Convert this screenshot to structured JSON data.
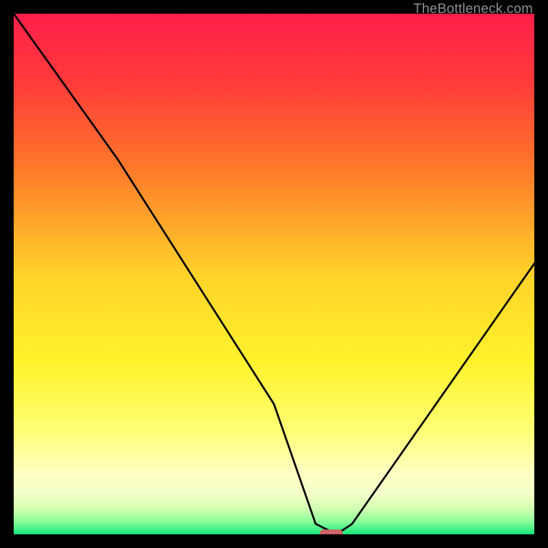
{
  "watermark": "TheBottleneck.com",
  "chart_data": {
    "type": "line",
    "title": "",
    "xlabel": "",
    "ylabel": "",
    "xlim": [
      0,
      100
    ],
    "ylim": [
      0,
      100
    ],
    "x": [
      0,
      20,
      50,
      58,
      62,
      65,
      100
    ],
    "values": [
      100,
      72,
      25,
      2,
      0,
      2,
      52
    ],
    "optimum_marker": {
      "x": 61,
      "y": 0
    },
    "background_gradient": {
      "stops": [
        {
          "pos": 0.0,
          "color": "#ff1f4b"
        },
        {
          "pos": 0.13,
          "color": "#ff3a3a"
        },
        {
          "pos": 0.3,
          "color": "#ff7a2a"
        },
        {
          "pos": 0.5,
          "color": "#ffd22a"
        },
        {
          "pos": 0.67,
          "color": "#fff22c"
        },
        {
          "pos": 0.8,
          "color": "#ffff74"
        },
        {
          "pos": 0.88,
          "color": "#ffffc0"
        },
        {
          "pos": 0.92,
          "color": "#f4ffca"
        },
        {
          "pos": 0.95,
          "color": "#d4ffb2"
        },
        {
          "pos": 0.975,
          "color": "#8cff9c"
        },
        {
          "pos": 1.0,
          "color": "#17e87c"
        }
      ]
    }
  }
}
